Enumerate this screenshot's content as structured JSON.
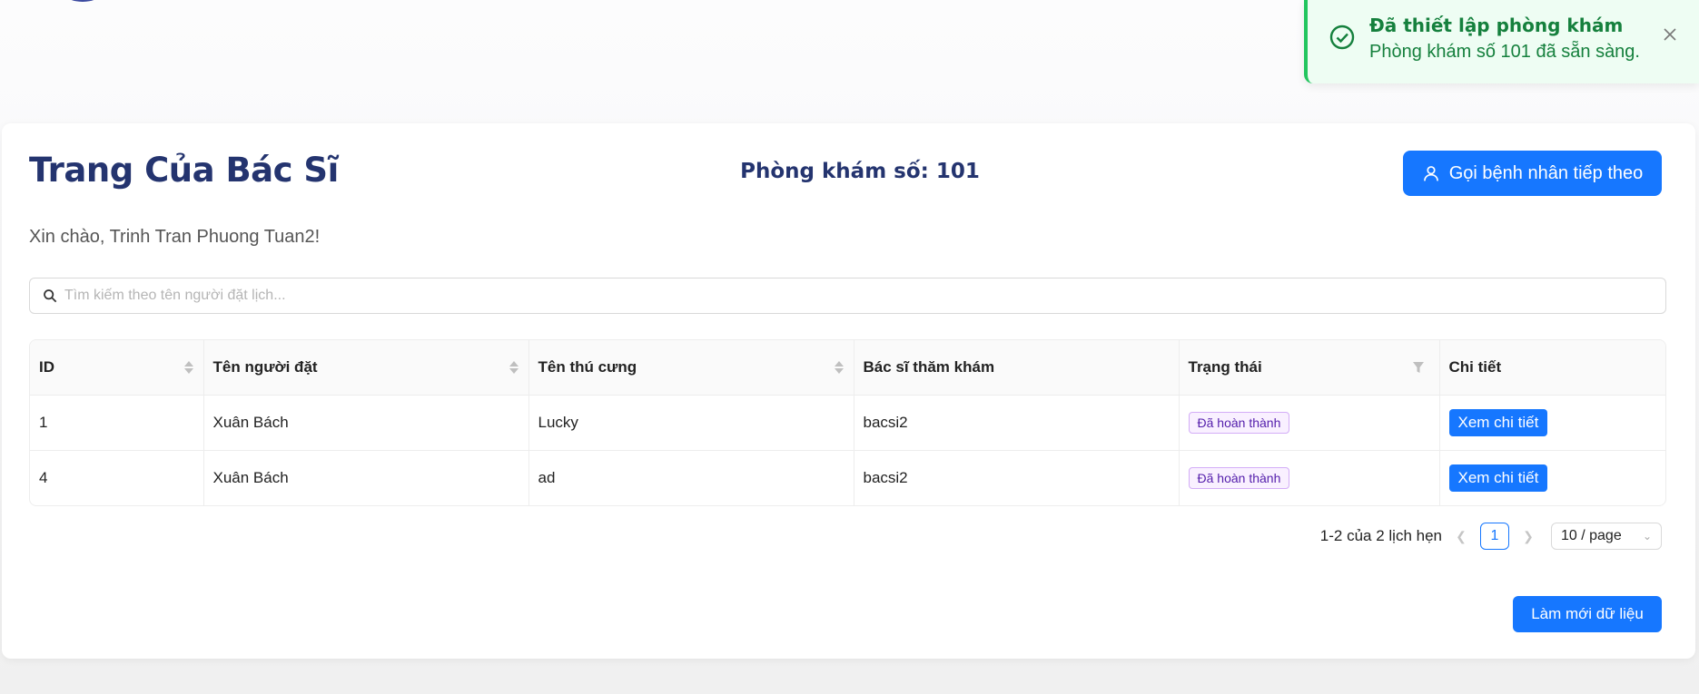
{
  "header": {
    "title": "Trang Của Bác Sĩ",
    "room": "Phòng khám số: 101",
    "call_button": "Gọi bệnh nhân tiếp theo",
    "call_icon": "user-icon",
    "greeting": "Xin chào, Trinh Tran Phuong Tuan2!"
  },
  "search": {
    "placeholder": "Tìm kiếm theo tên người đặt lịch...",
    "value": "",
    "icon": "search-icon"
  },
  "table": {
    "columns": [
      "ID",
      "Tên người đặt",
      "Tên thú cưng",
      "Bác sĩ thăm khám",
      "Trạng thái",
      "Chi tiết"
    ],
    "rows": [
      {
        "id": "1",
        "owner": "Xuân Bách",
        "pet": "Lucky",
        "doctor": "bacsi2",
        "status": "Đã hoàn thành",
        "action": "Xem chi tiết"
      },
      {
        "id": "4",
        "owner": "Xuân Bách",
        "pet": "ad",
        "doctor": "bacsi2",
        "status": "Đã hoàn thành",
        "action": "Xem chi tiết"
      }
    ]
  },
  "pagination": {
    "summary": "1-2 của 2 lịch hẹn",
    "current_page": "1",
    "page_size": "10 / page"
  },
  "refresh_button": "Làm mới dữ liệu",
  "toast": {
    "title": "Đã thiết lập phòng khám",
    "message": "Phòng khám số 101 đã sẵn sàng.",
    "icon": "check-circle-icon",
    "close_icon": "close-icon"
  },
  "colors": {
    "primary": "#1677ff",
    "title": "#24346f",
    "success": "#15803d",
    "status_tag_text": "#531dab",
    "status_tag_bg": "#f9f0ff"
  }
}
